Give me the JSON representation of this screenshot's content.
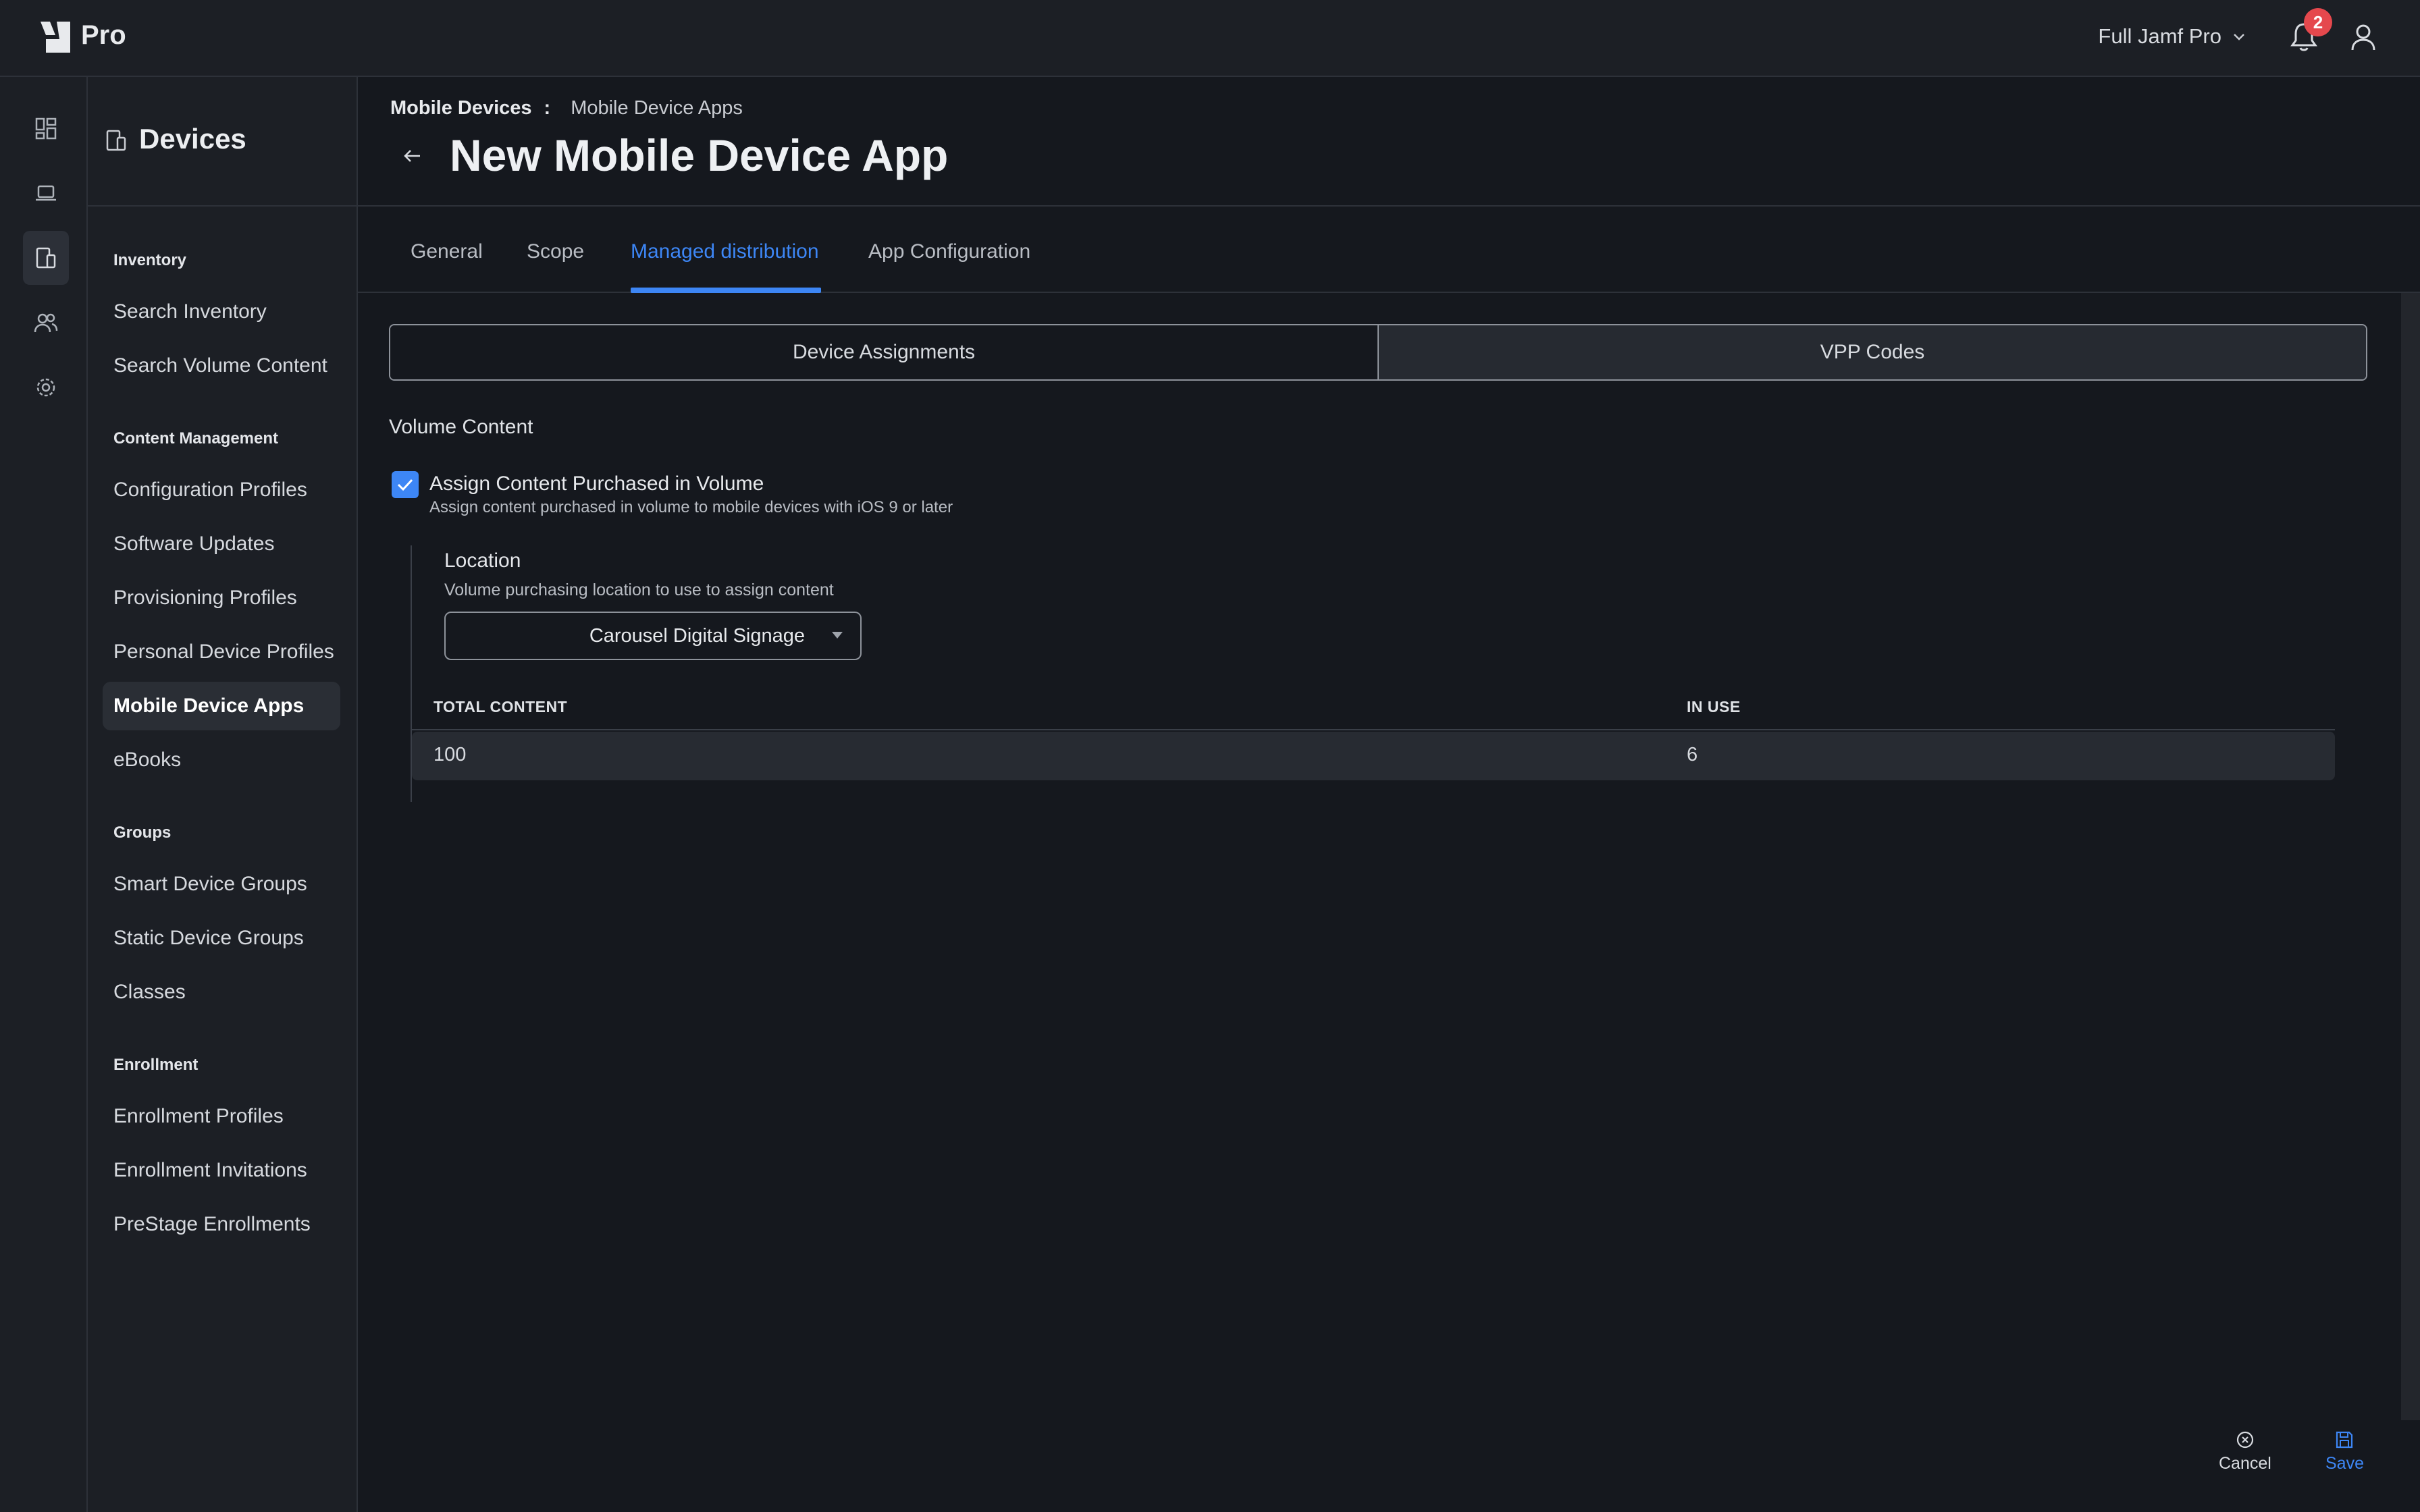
{
  "app": {
    "logo_text": "Pro"
  },
  "header": {
    "account": "Full Jamf Pro",
    "notification_count": "2"
  },
  "rail": {
    "items": [
      "dashboard-icon",
      "computer-icon",
      "mobile-device-icon",
      "users-icon",
      "settings-icon"
    ],
    "active": "mobile-device-icon"
  },
  "sidebar": {
    "title": "Devices",
    "sections": [
      {
        "label": "Inventory",
        "items": [
          "Search Inventory",
          "Search Volume Content"
        ]
      },
      {
        "label": "Content Management",
        "items": [
          "Configuration Profiles",
          "Software Updates",
          "Provisioning Profiles",
          "Personal Device Profiles",
          "Mobile Device Apps",
          "eBooks"
        ]
      },
      {
        "label": "Groups",
        "items": [
          "Smart Device Groups",
          "Static Device Groups",
          "Classes"
        ]
      },
      {
        "label": "Enrollment",
        "items": [
          "Enrollment Profiles",
          "Enrollment Invitations",
          "PreStage Enrollments"
        ]
      }
    ],
    "active_item": "Mobile Device Apps"
  },
  "breadcrumb": {
    "first": "Mobile Devices",
    "separator": ":",
    "second": "Mobile Device Apps"
  },
  "page": {
    "title": "New Mobile Device App"
  },
  "tabs": [
    "General",
    "Scope",
    "Managed distribution",
    "App Configuration"
  ],
  "active_tab": "Managed distribution",
  "segments": {
    "left": "Device Assignments",
    "right": "VPP Codes"
  },
  "volume": {
    "section_label": "Volume Content",
    "checkbox_label": "Assign Content Purchased in Volume",
    "checkbox_desc": "Assign content purchased in volume to mobile devices with iOS 9 or later",
    "checked": true,
    "location_label": "Location",
    "location_desc": "Volume purchasing location to use to assign content",
    "location_value": "Carousel Digital Signage"
  },
  "table": {
    "headers": [
      "TOTAL CONTENT",
      "IN USE"
    ],
    "rows": [
      [
        "100",
        "6"
      ]
    ]
  },
  "actions": {
    "cancel": "Cancel",
    "save": "Save"
  },
  "colors": {
    "accent": "#3d86f5",
    "badge": "#e5484d",
    "background": "#15181e"
  }
}
